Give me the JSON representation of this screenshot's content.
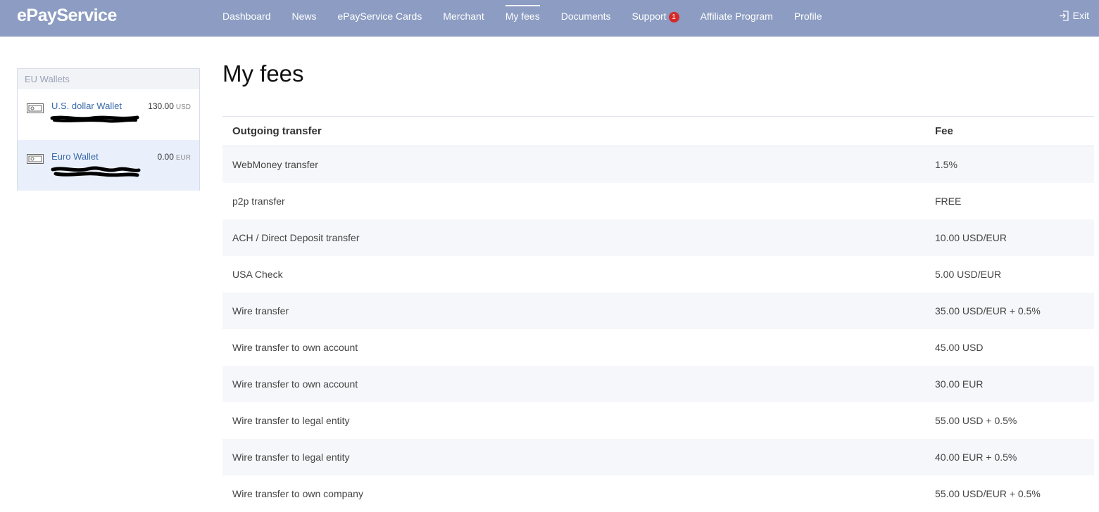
{
  "app": {
    "logo": "ePayService"
  },
  "nav": {
    "items": [
      {
        "label": "Dashboard"
      },
      {
        "label": "News"
      },
      {
        "label": "ePayService Cards"
      },
      {
        "label": "Merchant"
      },
      {
        "label": "My fees",
        "active": true
      },
      {
        "label": "Documents"
      },
      {
        "label": "Support",
        "badge": "1"
      },
      {
        "label": "Affiliate Program"
      },
      {
        "label": "Profile"
      }
    ],
    "exit_label": "Exit"
  },
  "sidebar": {
    "title": "EU Wallets",
    "wallets": [
      {
        "name": "U.S. dollar Wallet",
        "amount": "130.00",
        "currency": "USD"
      },
      {
        "name": "Euro Wallet",
        "amount": "0.00",
        "currency": "EUR",
        "selected": true
      }
    ]
  },
  "page": {
    "title": "My fees"
  },
  "fees": {
    "headers": {
      "transfer": "Outgoing transfer",
      "fee": "Fee"
    },
    "rows": [
      {
        "transfer": "WebMoney transfer",
        "fee": "1.5%"
      },
      {
        "transfer": "p2p transfer",
        "fee": "FREE"
      },
      {
        "transfer": "ACH / Direct Deposit transfer",
        "fee": "10.00 USD/EUR"
      },
      {
        "transfer": "USA Check",
        "fee": "5.00 USD/EUR"
      },
      {
        "transfer": "Wire transfer",
        "fee": "35.00 USD/EUR + 0.5%"
      },
      {
        "transfer": "Wire transfer to own account",
        "fee": "45.00 USD"
      },
      {
        "transfer": "Wire transfer to own account",
        "fee": "30.00 EUR"
      },
      {
        "transfer": "Wire transfer to legal entity",
        "fee": "55.00 USD + 0.5%"
      },
      {
        "transfer": "Wire transfer to legal entity",
        "fee": "40.00 EUR + 0.5%"
      },
      {
        "transfer": "Wire transfer to own company",
        "fee": "55.00 USD/EUR + 0.5%"
      }
    ]
  },
  "colors": {
    "header_bg": "#8c9cc2",
    "link": "#3a6aa8",
    "badge": "#d62a2a",
    "selected_wallet_bg": "#eaf0fb"
  }
}
